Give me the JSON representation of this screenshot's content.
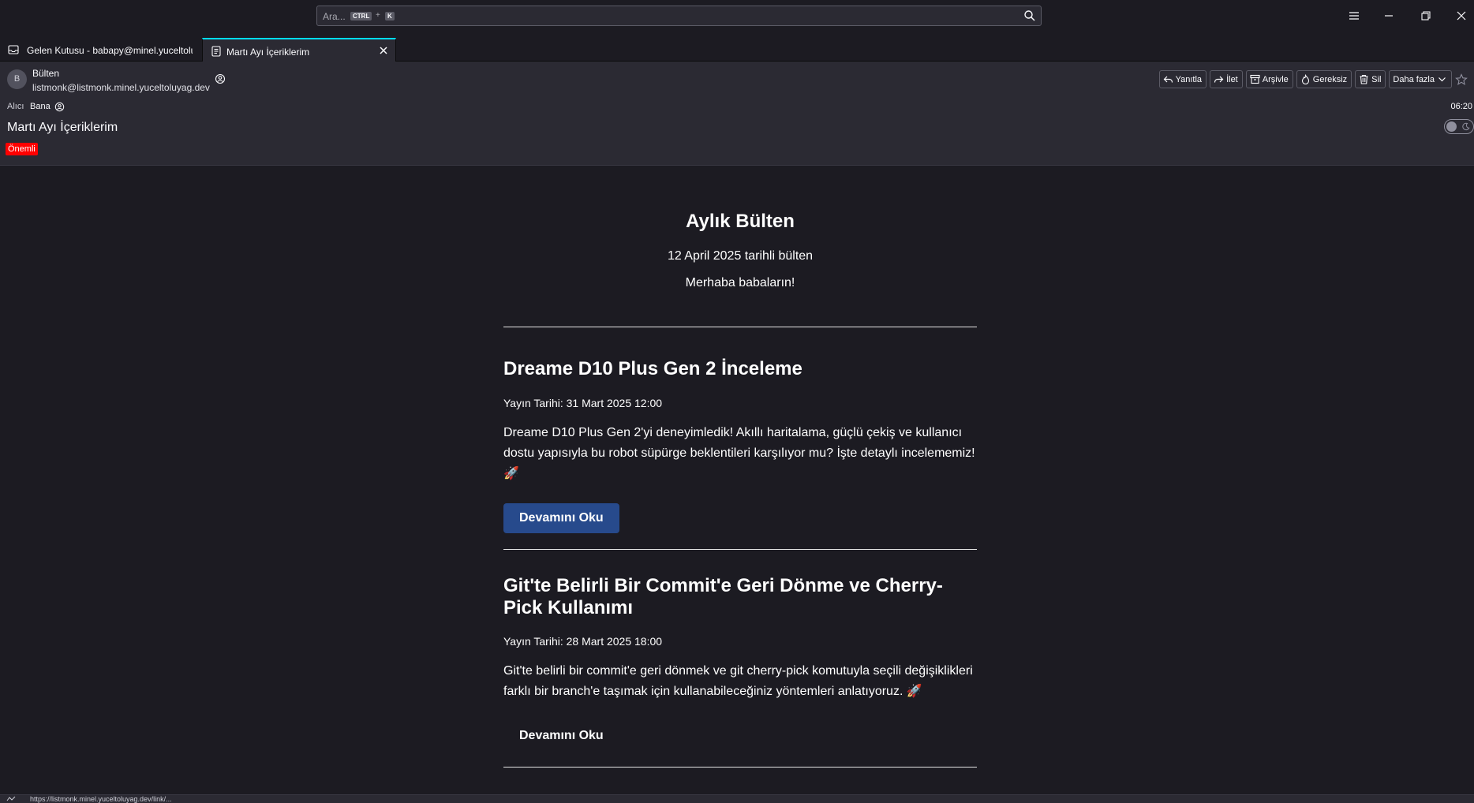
{
  "search": {
    "placeholder": "Ara...",
    "key1": "CTRL",
    "plus": "+",
    "key2": "K"
  },
  "tabs": [
    {
      "label": "Gelen Kutusu - babapy@minel.yuceltoluyag.dev",
      "icon": "inbox-icon"
    },
    {
      "label": "Martı Ayı İçeriklerim",
      "icon": "message-icon"
    }
  ],
  "message": {
    "avatar_letter": "B",
    "sender_name": "Bülten",
    "sender_email": "listmonk@listmonk.minel.yuceltoluyag.dev",
    "recipient_label": "Alıcı",
    "recipient_value": "Bana",
    "time": "06:20",
    "subject": "Martı Ayı İçeriklerim",
    "tag": "Önemli",
    "tag_color": "#ff0000"
  },
  "actions": {
    "reply": "Yanıtla",
    "forward": "İlet",
    "archive": "Arşivle",
    "junk": "Gereksiz",
    "delete": "Sil",
    "more": "Daha fazla"
  },
  "newsletter": {
    "title": "Aylık Bülten",
    "date_line": "12 April 2025 tarihli bülten",
    "greeting": "Merhaba babaların!",
    "articles": [
      {
        "title": "Dreame D10 Plus Gen 2 İnceleme",
        "date": "Yayın Tarihi: 31 Mart 2025 12:00",
        "desc": "Dreame D10 Plus Gen 2'yi deneyimledik! Akıllı haritalama, güçlü çekiş ve kullanıcı dostu yapısıyla bu robot süpürge beklentileri karşılıyor mu? İşte detaylı incelememiz! 🚀",
        "button": "Devamını Oku"
      },
      {
        "title": "Git'te Belirli Bir Commit'e Geri Dönme ve Cherry-Pick Kullanımı",
        "date": "Yayın Tarihi: 28 Mart 2025 18:00",
        "desc": "Git'te belirli bir commit'e geri dönmek ve git cherry-pick komutuyla seçili değişiklikleri farklı bir branch'e taşımak için kullanabileceğiniz yöntemleri anlatıyoruz. 🚀",
        "button": "Devamını Oku"
      }
    ],
    "button_color": "#274a8c"
  },
  "statusbar": {
    "text": "https://listmonk.minel.yuceltoluyag.dev/link/..."
  }
}
